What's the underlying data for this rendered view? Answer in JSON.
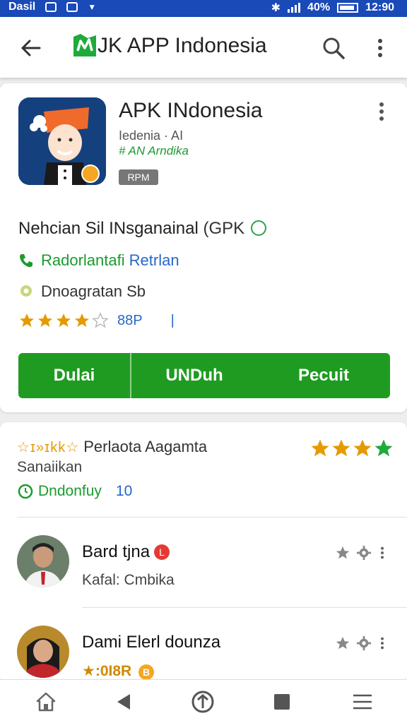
{
  "status_bar": {
    "carrier": "Dasil",
    "battery_text": "40%",
    "time": "12:90"
  },
  "app_bar": {
    "title": "JK APP Indonesia",
    "icons": [
      "back-arrow-icon",
      "app-logo-icon",
      "search-icon",
      "more-vert-icon"
    ]
  },
  "app": {
    "name": "APK INdonesia",
    "developer": "Iedenia · AI",
    "category": "# AN Arndika",
    "badge": "RPM",
    "description": "Nehcian Sil INsganainal",
    "version": "(GPK",
    "contact_label": "Radorlantafi",
    "contact_link": "Retrlan",
    "location_label": "Dnoagratan Sb",
    "rating": 4,
    "rating_count": "88P",
    "rating_separator": "|",
    "buttons": {
      "left": "Dulai",
      "middle": "UNDuh",
      "right": "Pecuit"
    }
  },
  "reviews_section": {
    "header_stars": "☆ɪ»ɪkk☆",
    "header_title": "Perlaota Aagamta",
    "subtitle": "Sanaiikan",
    "right_rating": 4,
    "update_label": "Dndonfuy",
    "update_count": "10",
    "reviews": [
      {
        "name": "Bard tjna",
        "badge": "L",
        "badge_color": "#e53935",
        "sub": "Kafal: Cmbika",
        "sub_style": "normal"
      },
      {
        "name": "Dami Elerl dounza",
        "badge": "B",
        "badge_color": "#f5a623",
        "sub": "★:0I8R",
        "sub_style": "gold"
      }
    ]
  },
  "colors": {
    "status_bar": "#1a49b8",
    "primary_green": "#1f9b22",
    "link_blue": "#2766c8",
    "star_orange": "#e59a00",
    "star_green": "#1faa3c"
  }
}
